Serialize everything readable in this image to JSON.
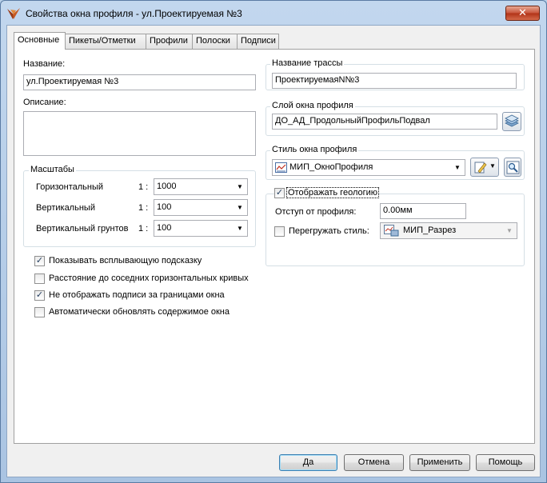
{
  "window": {
    "title": "Свойства окна профиля - ул.Проектируемая №3",
    "close_glyph": "✕"
  },
  "tabs": [
    {
      "label": "Основные",
      "active": true
    },
    {
      "label": "Пикеты/Отметки"
    },
    {
      "label": "Профили"
    },
    {
      "label": "Полоски"
    },
    {
      "label": "Подписи"
    }
  ],
  "left": {
    "name_label": "Название:",
    "name_value": "ул.Проектируемая №3",
    "desc_label": "Описание:",
    "desc_value": "",
    "scales": {
      "title": "Масштабы",
      "rows": [
        {
          "label": "Горизонтальный",
          "prefix": "1 :",
          "value": "1000"
        },
        {
          "label": "Вертикальный",
          "prefix": "1 :",
          "value": "100"
        },
        {
          "label": "Вертикальный  грунтов",
          "prefix": "1 :",
          "value": "100"
        }
      ]
    },
    "options": [
      {
        "label": "Показывать всплывающую подсказку",
        "checked": true,
        "check_glyph": "✓"
      },
      {
        "label": "Расстояние до соседних горизонтальных кривых",
        "checked": false,
        "check_glyph": ""
      },
      {
        "label": "Не отображать подписи за границами окна",
        "checked": true,
        "check_glyph": "✓"
      },
      {
        "label": "Автоматически обновлять содержимое окна",
        "checked": false,
        "check_glyph": ""
      }
    ]
  },
  "right": {
    "route": {
      "title": "Название трассы",
      "value": "ПроектируемаяN№3"
    },
    "layer": {
      "title": "Слой окна профиля",
      "value": "ДО_АД_ПродольныйПрофильПодвал",
      "icon": "layers-icon"
    },
    "style": {
      "title": "Стиль окна профиля",
      "value": "МИП_ОкноПрофиля",
      "icon": "profile-style-icon"
    },
    "geology": {
      "show_label": "Отображать геологию",
      "show_checked": true,
      "check_glyph": "✓",
      "offset_label": "Отступ от профиля:",
      "offset_value": "0.00мм",
      "override_label": "Перегружать стиль:",
      "override_checked": false,
      "override_value": "МИП_Разрез"
    }
  },
  "buttons": {
    "ok": "Да",
    "cancel": "Отмена",
    "apply": "Применить",
    "help": "Помощь"
  },
  "glyphs": {
    "dropdown": "▼"
  },
  "colors": {
    "title_bar": "#b9d1ea",
    "close": "#c7533a",
    "panel": "#ffffff",
    "dialog": "#f0f0f0"
  }
}
